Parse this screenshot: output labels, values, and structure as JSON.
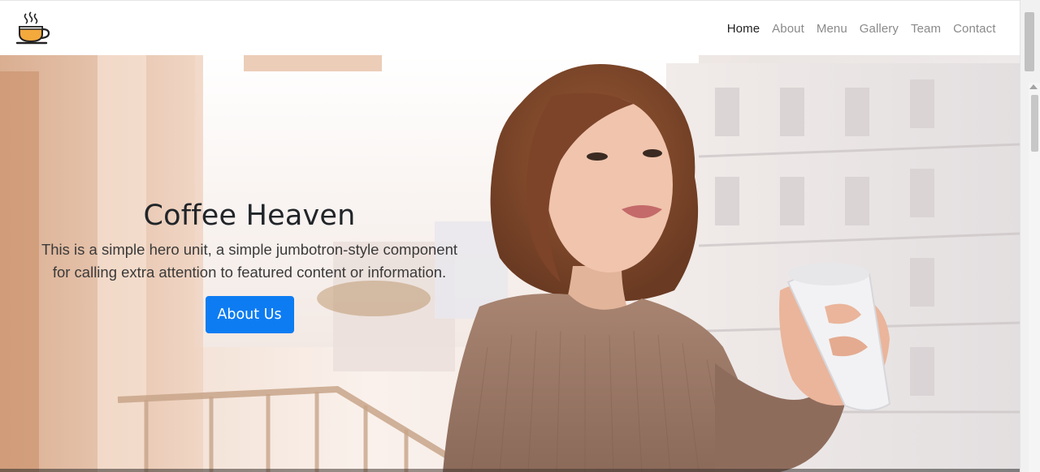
{
  "brand": {
    "logo": "coffee-cup-icon"
  },
  "nav": {
    "items": [
      {
        "label": "Home",
        "active": true
      },
      {
        "label": "About",
        "active": false
      },
      {
        "label": "Menu",
        "active": false
      },
      {
        "label": "Gallery",
        "active": false
      },
      {
        "label": "Team",
        "active": false
      },
      {
        "label": "Contact",
        "active": false
      }
    ]
  },
  "hero": {
    "title": "Coffee Heaven",
    "lead": "This is a simple hero unit, a simple jumbotron-style component for calling extra attention to featured content or information.",
    "button_label": "About Us",
    "image": "woman-holding-coffee-mug-on-balcony"
  },
  "colors": {
    "primary": "#0d7cf2",
    "nav_active": "#222222",
    "nav_inactive": "#8a8a8a",
    "heading": "#212529"
  }
}
